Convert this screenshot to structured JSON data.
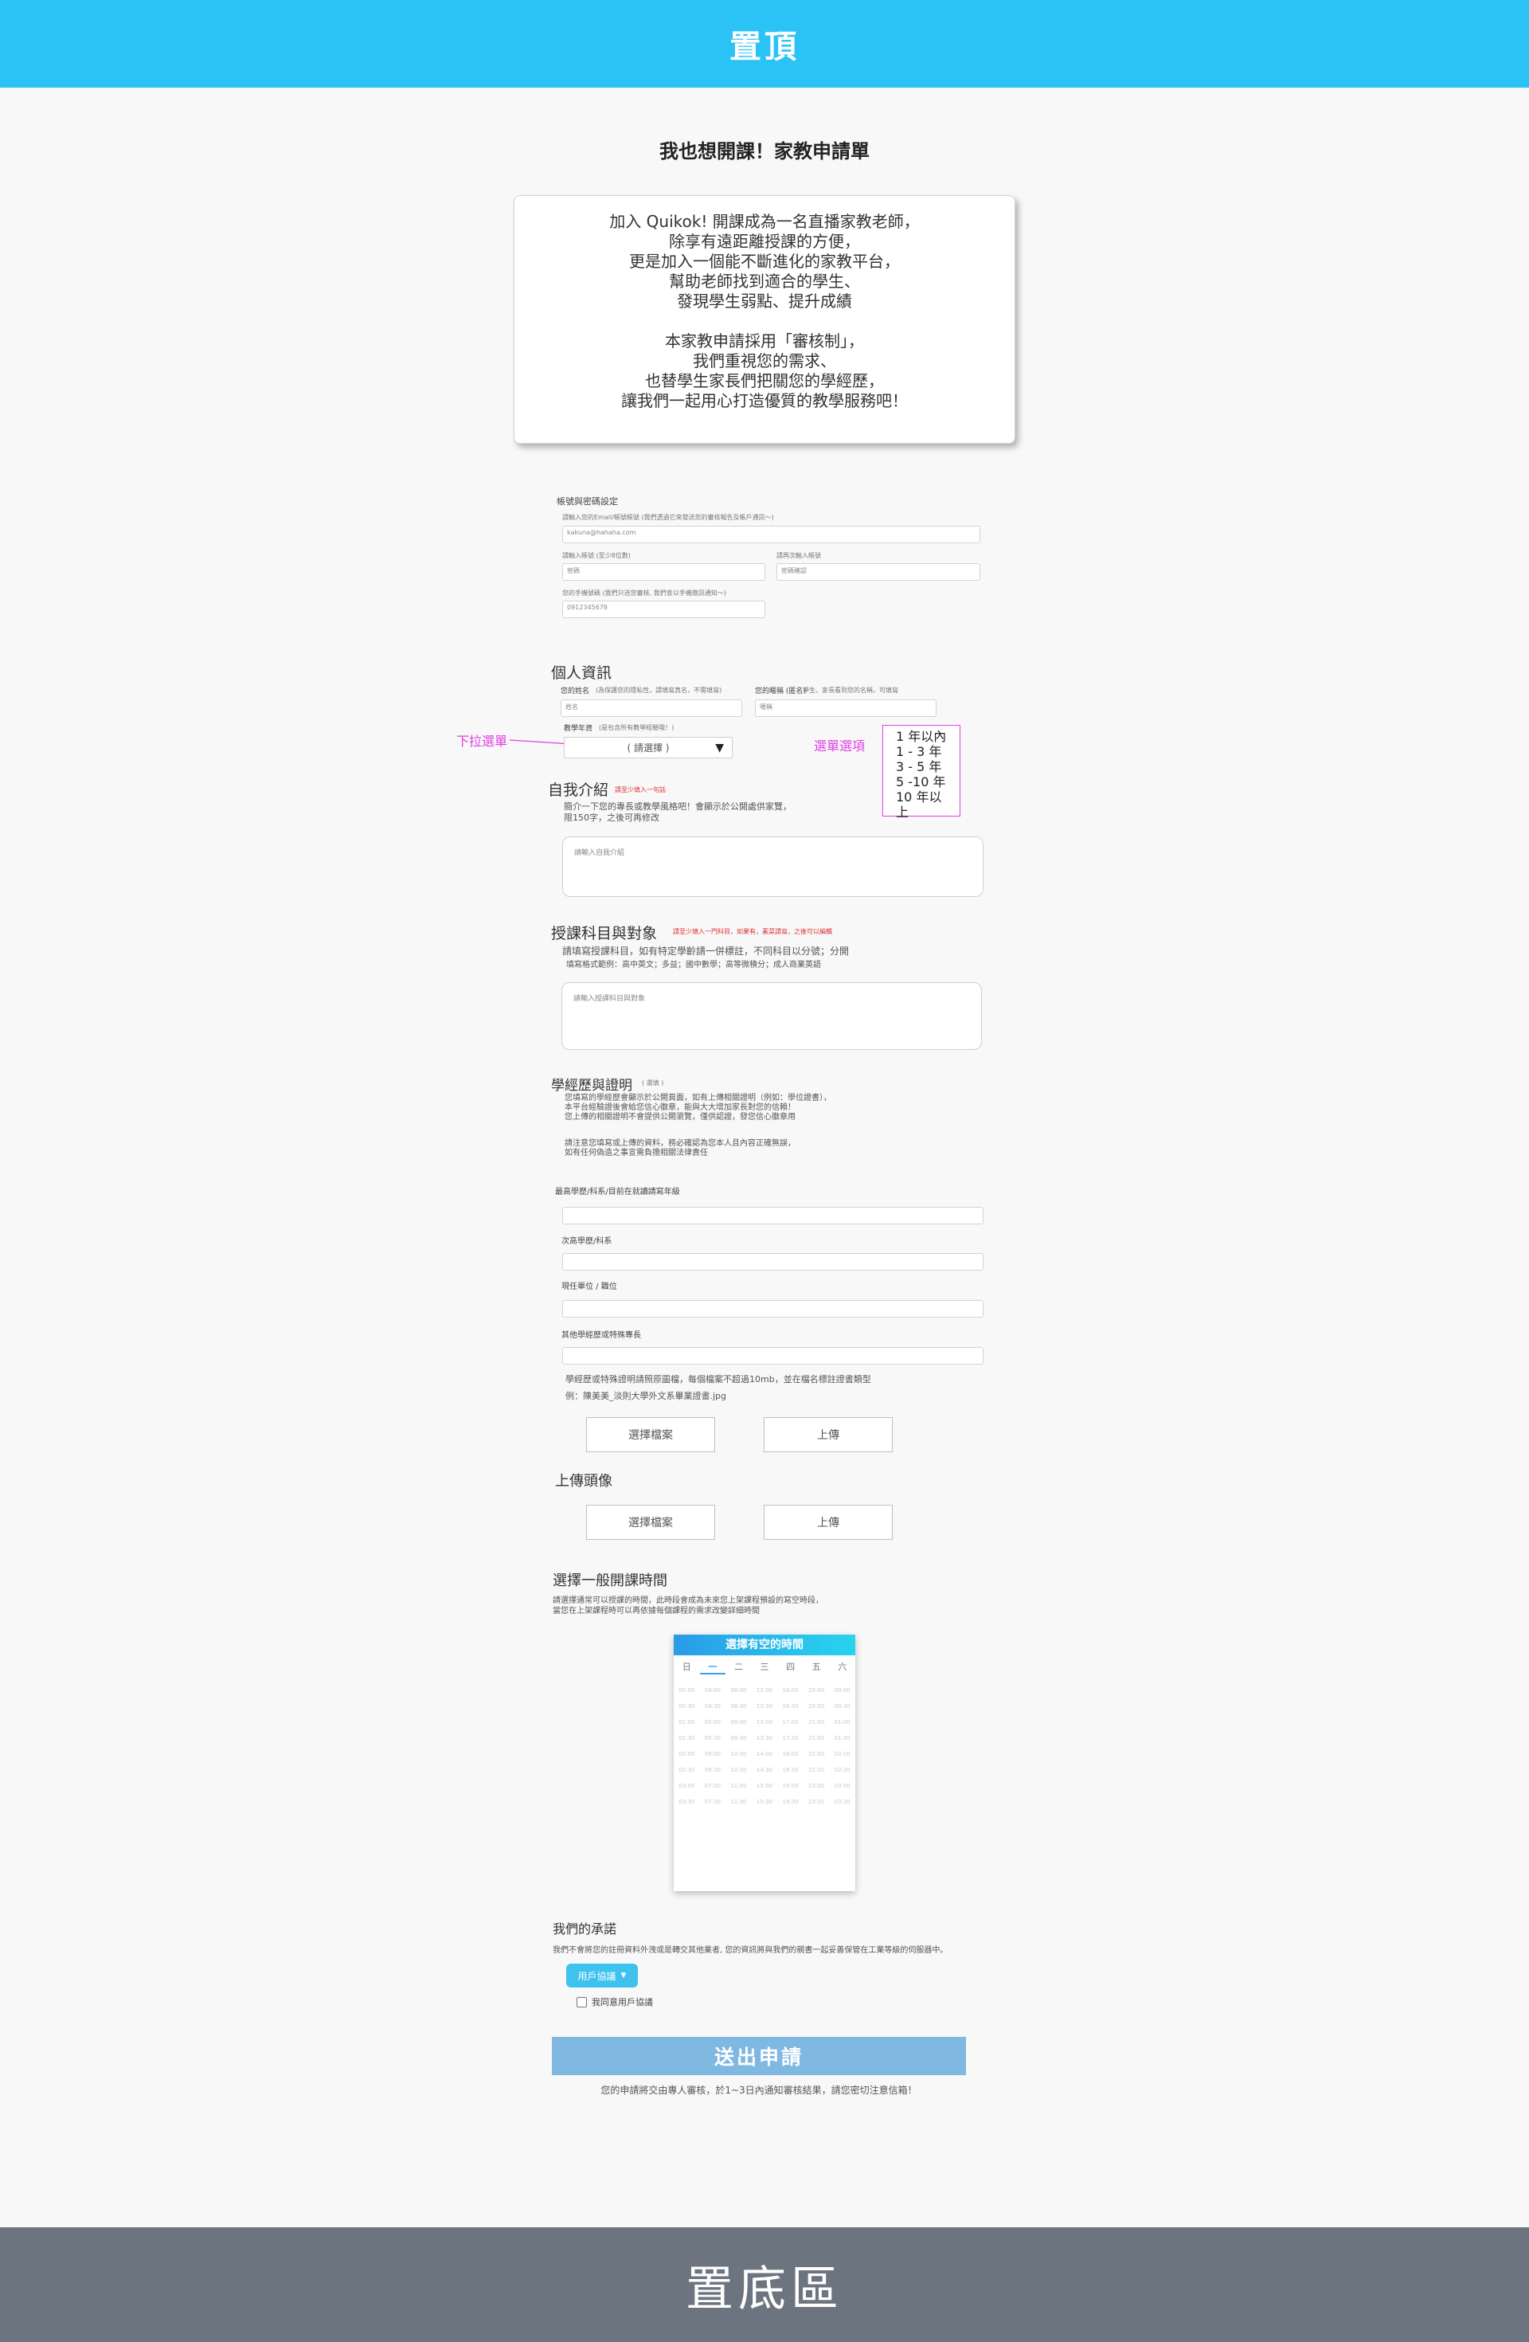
{
  "header": {
    "title": "置頂"
  },
  "footer": {
    "title": "置底區"
  },
  "page_title": "我也想開課！家教申請單",
  "intro": {
    "lines1": [
      "加入 Quikok! 開課成為一名直播家教老師，",
      "除享有遠距離授課的方便，",
      "更是加入一個能不斷進化的家教平台，",
      "幫助老師找到適合的學生、",
      "發現學生弱點、提升成績"
    ],
    "lines2": [
      "本家教申請採用「審核制」，",
      "我們重視您的需求、",
      "也替學生家長們把關您的學經歷，",
      "讓我們一起用心打造優質的教學服務吧！"
    ]
  },
  "account": {
    "heading": "帳號與密碼設定",
    "email_label": "請輸入您的Email/帳號帳號 (我們透過它來發送您的審核報告及帳戶通訊～)",
    "email_value": "kakuna@hahaha.com",
    "password_label": "請輸入帳號 (至少8位數)",
    "password_value": "密碼",
    "password_confirm_label": "請再次輸入帳號",
    "password_confirm_value": "密碼確認",
    "phone_label": "您的手機號碼 (我們只送您審核, 我們會以手機簡訊通知～)",
    "phone_value": "0912345678"
  },
  "personal": {
    "heading": "個人資訊",
    "name_label": "您的姓名",
    "name_hint": "(為保護您的隱私性，請填寫真名，不需填寫)",
    "name_value": "姓名",
    "nickname_label": "您的暱稱 (匿名)",
    "nickname_hint": "學生、家長看到您的名稱，可填寫",
    "nickname_value": "暱稱",
    "experience_label": "教學年資",
    "experience_hint": "(是包含所有教學經驗哦！)",
    "select_placeholder": "( 請選擇 )",
    "dropdown_annotation": "下拉選單",
    "options_annotation": "選單選項",
    "options": [
      "1 年以內",
      "1 - 3 年",
      "3 - 5 年",
      "5 -10 年",
      "10 年以上"
    ]
  },
  "intro_section": {
    "heading": "自我介紹",
    "required_hint": "請至少填入一句話",
    "desc1": "簡介一下您的專長或教學風格吧！會顯示於公開處供家覽，",
    "desc2": "限150字，之後可再修改",
    "placeholder": "請輸入自我介紹"
  },
  "subjects": {
    "heading": "授課科目與對象",
    "required_hint": "請至少填入一門科目，如果有，素菜請寫，之後可以編輯",
    "desc1": "請填寫授課科目，如有特定學齡請一併標註，不同科目以分號；分開",
    "desc2": "填寫格式範例：高中英文；多益；國中數學；高等微積分；成人商業英語",
    "placeholder": "請輸入授課科目與對象"
  },
  "education": {
    "heading": "學經歷與證明",
    "optional": "( 選填 )",
    "note1": [
      "您填寫的學經歷會顯示於公開頁面，如有上傳相關證明（例如：學位證書），",
      "本平台經驗證後會給您信心徽章，能與大大增加家長對您的信賴！",
      "您上傳的相關證明不會提供公開瀏覽，僅供認證，發您信心徽章用"
    ],
    "note2": [
      "請注意您填寫或上傳的資料，務必確認為您本人且內容正確無誤，",
      "如有任何偽造之事宣需負擔相關法律責任"
    ],
    "field1": "最高學歷/科系/目前在就讀請寫年級",
    "field2": "次高學歷/科系",
    "field3": "現任單位 / 職位",
    "field4": "其他學經歷或特殊專長",
    "upload_note1": "學經歷或特殊證明請照原圖檔，每個檔案不超過10mb，並在檔名標註證書類型",
    "upload_note2": "例：陳美美_淡則大學外文系畢業證書.jpg",
    "choose_file": "選擇檔案",
    "upload": "上傳"
  },
  "avatar": {
    "heading": "上傳頭像",
    "choose_file": "選擇檔案",
    "upload": "上傳"
  },
  "schedule": {
    "heading": "選擇一般開課時間",
    "desc1": "請選擇通常可以授課的時間，此時段會成為未來您上架課程預設的寫空時段，",
    "desc2": "當您在上架課程時可以再依據每個課程的需求改變詳細時間",
    "calendar_title": "選擇有空的時間",
    "days": [
      "日",
      "一",
      "二",
      "三",
      "四",
      "五",
      "六"
    ],
    "slots": [
      [
        "00:00",
        "04:00",
        "08:00",
        "12:00",
        "16:00",
        "20:00",
        "00:00"
      ],
      [
        "00:30",
        "04:30",
        "08:30",
        "12:30",
        "16:30",
        "20:30",
        "00:30"
      ],
      [
        "01:00",
        "05:00",
        "09:00",
        "13:00",
        "17:00",
        "21:00",
        "01:00"
      ],
      [
        "01:30",
        "05:30",
        "09:30",
        "13:30",
        "17:30",
        "21:30",
        "01:30"
      ],
      [
        "02:00",
        "06:00",
        "10:00",
        "14:00",
        "18:00",
        "22:00",
        "02:00"
      ],
      [
        "02:30",
        "06:30",
        "10:30",
        "14:30",
        "18:30",
        "22:30",
        "02:30"
      ],
      [
        "03:00",
        "07:00",
        "11:00",
        "15:00",
        "19:00",
        "23:00",
        "03:00"
      ],
      [
        "03:30",
        "07:30",
        "11:30",
        "15:30",
        "19:30",
        "23:30",
        "03:30"
      ]
    ]
  },
  "commitment": {
    "heading": "我們的承諾",
    "desc": "我們不會將您的註冊資料外洩或是轉交其他業者, 您的資訊將與我們的親書一起妥善保管在工業等級的伺服器中。",
    "agreement_button": "用戶協議",
    "checkbox_label": "我同意用戶協議"
  },
  "submit": {
    "label": "送出申請",
    "note": "您的申請將交由專人審核，於1~3日內通知審核結果，請您密切注意信箱！"
  }
}
